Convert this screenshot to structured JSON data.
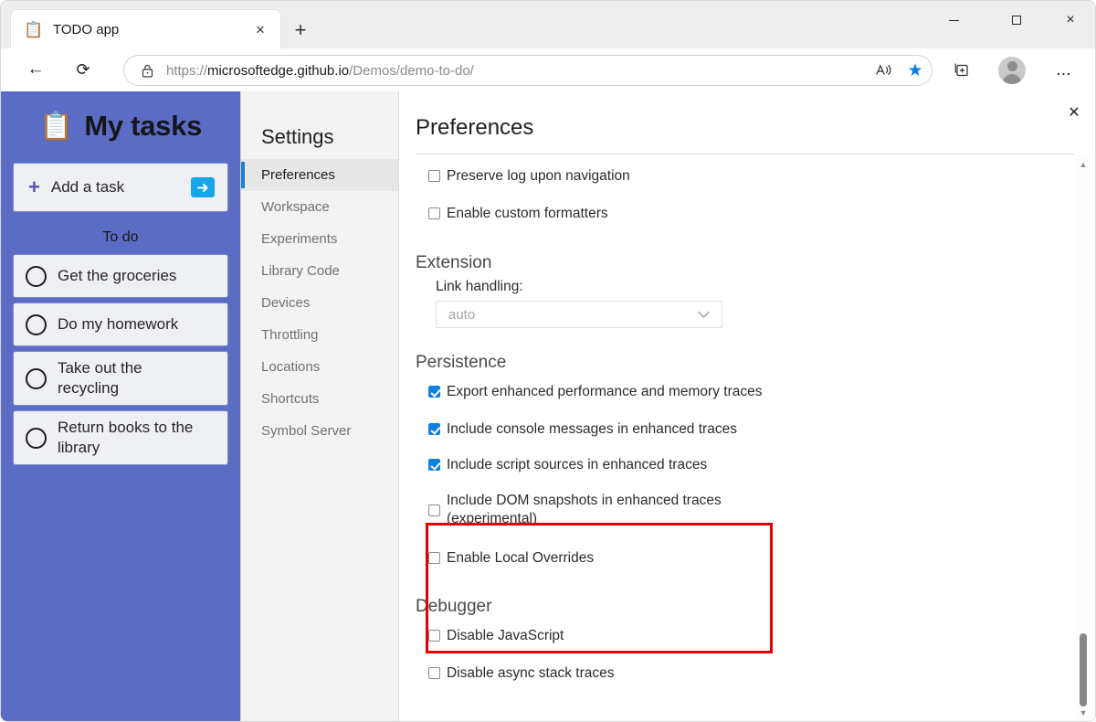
{
  "browser": {
    "tab": {
      "favicon": "clipboard-icon",
      "title": "TODO app",
      "close_label": "×"
    },
    "newtab_label": "+",
    "window_controls": {
      "minimize": "minimize-icon",
      "maximize": "maximize-icon",
      "close": "×"
    },
    "toolbar": {
      "back_label": "←",
      "reload_label": "⟳",
      "lock_icon": "lock-icon",
      "url_scheme": "https://",
      "url_host": "microsoftedge.github.io",
      "url_path": "/Demos/demo-to-do/",
      "read_aloud_label": "A",
      "favorite_label": "★",
      "collections_label": "collections-icon",
      "profile_label": "profile-avatar",
      "more_label": "…"
    }
  },
  "todo_app": {
    "emoji": "📋",
    "title": "My tasks",
    "add_task": {
      "plus": "+",
      "label": "Add a task",
      "submit": "⮕"
    },
    "section_label": "To do",
    "tasks": [
      {
        "label": "Get the groceries"
      },
      {
        "label": "Do my homework"
      },
      {
        "label": "Take out the recycling"
      },
      {
        "label": "Return books to the library"
      }
    ]
  },
  "devtools": {
    "close_label": "✕",
    "settings_heading": "Settings",
    "nav_items": [
      {
        "label": "Preferences",
        "selected": true
      },
      {
        "label": "Workspace",
        "selected": false
      },
      {
        "label": "Experiments",
        "selected": false
      },
      {
        "label": "Library Code",
        "selected": false
      },
      {
        "label": "Devices",
        "selected": false
      },
      {
        "label": "Throttling",
        "selected": false
      },
      {
        "label": "Locations",
        "selected": false
      },
      {
        "label": "Shortcuts",
        "selected": false
      },
      {
        "label": "Symbol Server",
        "selected": false
      }
    ],
    "content": {
      "title": "Preferences",
      "top_checkboxes": [
        {
          "label": "Preserve log upon navigation",
          "checked": false
        },
        {
          "label": "Enable custom formatters",
          "checked": false
        }
      ],
      "extension": {
        "group_title": "Extension",
        "field_label": "Link handling:",
        "select_value": "auto",
        "chevron": "∨"
      },
      "persistence": {
        "group_title": "Persistence",
        "checkboxes": [
          {
            "label": "Export enhanced performance and memory traces",
            "checked": true,
            "highlighted": false
          },
          {
            "label": "Include console messages in enhanced traces",
            "checked": true,
            "highlighted": true
          },
          {
            "label": "Include script sources in enhanced traces",
            "checked": true,
            "highlighted": true
          },
          {
            "label": "Include DOM snapshots in enhanced traces (experimental)",
            "checked": false,
            "highlighted": true
          },
          {
            "label": "Enable Local Overrides",
            "checked": false,
            "highlighted": false
          }
        ]
      },
      "debugger": {
        "group_title": "Debugger",
        "checkboxes": [
          {
            "label": "Disable JavaScript",
            "checked": false
          },
          {
            "label": "Disable async stack traces",
            "checked": false
          }
        ]
      }
    },
    "scrollbar": {
      "up": "▲",
      "down": "▼"
    },
    "highlight_color": "#e00000"
  }
}
